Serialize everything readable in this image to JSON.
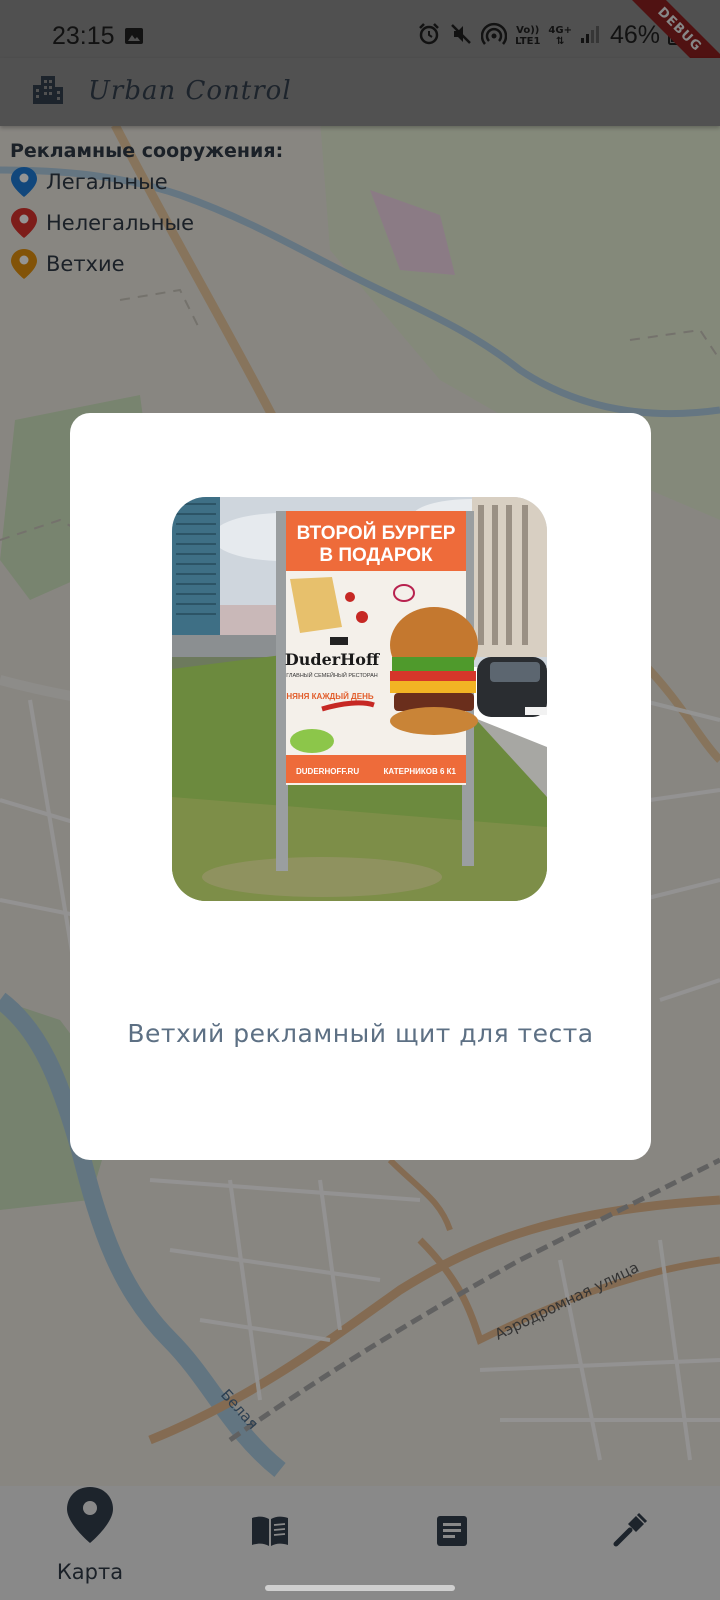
{
  "status_bar": {
    "time": "23:15",
    "network_top": "Vo))",
    "network_bottom": "LTE1",
    "signal_type": "4G+",
    "battery": "46%",
    "debug_label": "DEBUG",
    "icons": [
      "image-icon",
      "alarm-icon",
      "mute-icon",
      "hotspot-icon",
      "signal-icon",
      "battery-icon"
    ]
  },
  "app_bar": {
    "title": "Urban Control",
    "logo_icon": "city-buildings-icon"
  },
  "legend": {
    "title": "Рекламные сооружения:",
    "items": [
      {
        "label": "Легальные",
        "color": "#1e7bd6"
      },
      {
        "label": "Нелегальные",
        "color": "#d8322d"
      },
      {
        "label": "Ветхие",
        "color": "#e0900e"
      }
    ]
  },
  "map": {
    "street_labels": [
      "Аэродромная улица",
      "Белая"
    ]
  },
  "dialog": {
    "caption": "Ветхий рекламный щит для теста",
    "photo": {
      "headline_1": "ВТОРОЙ БУРГЕР",
      "headline_2": "В ПОДАРОК",
      "brand": "DuderHoff",
      "tagline": "ГЛАВНЫЙ СЕМЕЙНЫЙ РЕСТОРАН",
      "daily": "НЯНЯ КАЖДЫЙ ДЕНЬ",
      "site": "DUDERHOFF.RU",
      "address": "КАТЕРНИКОВ 6 К1",
      "plate": "Р"
    }
  },
  "bottom_nav": {
    "items": [
      {
        "label": "Карта",
        "icon": "map-pin-icon",
        "active": true
      },
      {
        "label": "",
        "icon": "book-icon",
        "active": false
      },
      {
        "label": "",
        "icon": "article-icon",
        "active": false
      },
      {
        "label": "",
        "icon": "tools-icon",
        "active": false
      }
    ]
  }
}
